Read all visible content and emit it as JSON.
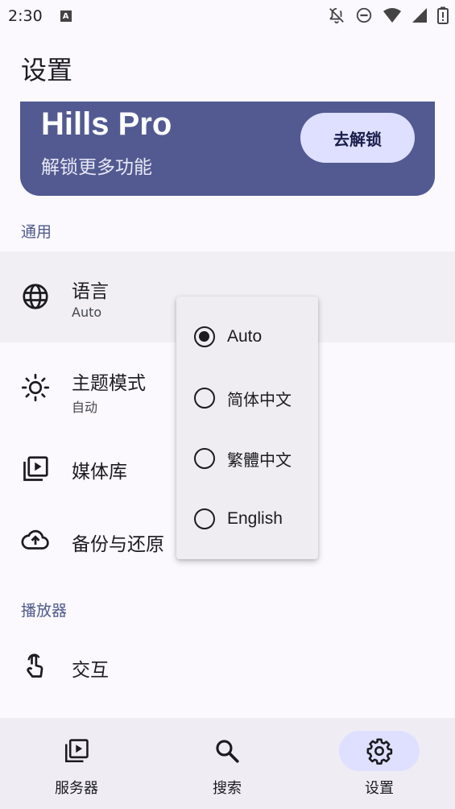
{
  "status_bar": {
    "time": "2:30",
    "notif_badge": "A"
  },
  "page": {
    "title": "设置"
  },
  "banner": {
    "title": "Hills Pro",
    "subtitle": "解锁更多功能",
    "button_label": "去解锁"
  },
  "sections": {
    "general": "通用",
    "player": "播放器"
  },
  "settings": {
    "language": {
      "title": "语言",
      "value": "Auto"
    },
    "theme": {
      "title": "主题模式",
      "value": "自动"
    },
    "media_library": {
      "title": "媒体库"
    },
    "backup": {
      "title": "备份与还原"
    },
    "interaction": {
      "title": "交互"
    }
  },
  "language_menu": {
    "options": [
      "Auto",
      "简体中文",
      "繁體中文",
      "English"
    ],
    "selected": "Auto"
  },
  "bottom_nav": {
    "items": [
      {
        "label": "服务器",
        "icon": "video-library-icon"
      },
      {
        "label": "搜索",
        "icon": "search-icon"
      },
      {
        "label": "设置",
        "icon": "gear-icon",
        "active": true
      }
    ]
  },
  "colors": {
    "banner_bg": "#525a91",
    "accent_container": "#dfe0ff",
    "section_header": "#4f5a8a",
    "background": "#fbf8fe"
  }
}
